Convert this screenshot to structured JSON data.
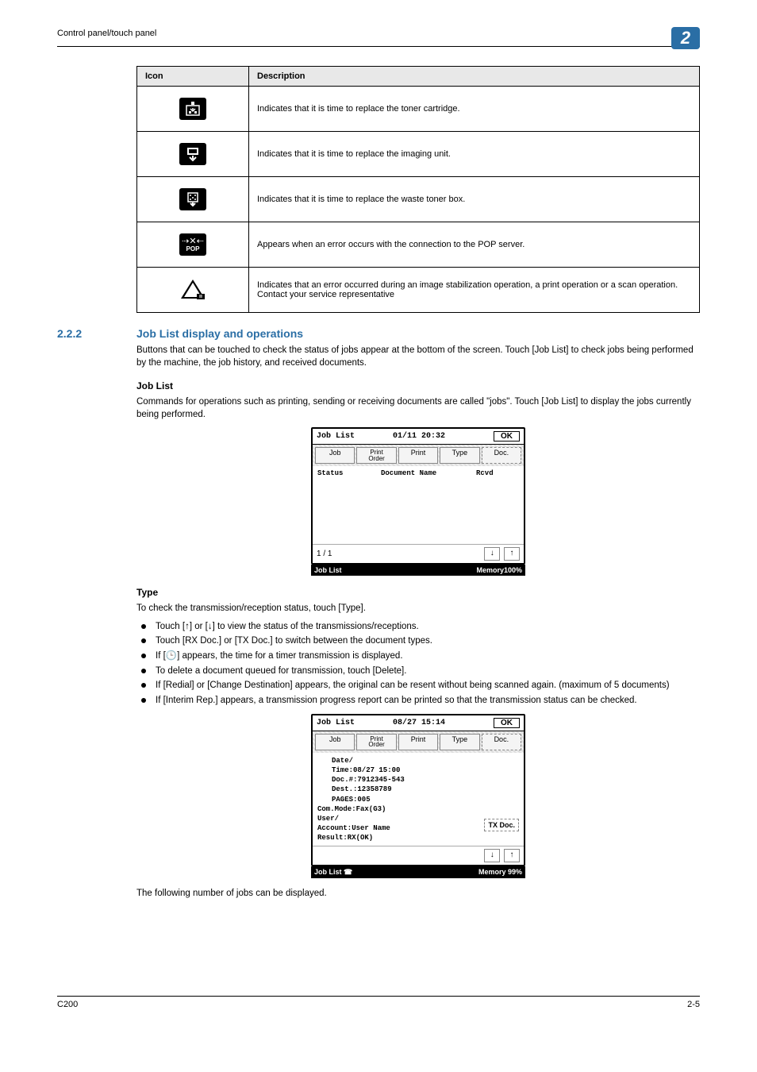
{
  "runningHead": "Control panel/touch panel",
  "chapter": "2",
  "iconTable": {
    "headers": [
      "Icon",
      "Description"
    ],
    "rows": [
      {
        "iconName": "toner-cartridge-icon",
        "glyph": "⊞",
        "desc": "Indicates that it is time to replace the toner cartridge."
      },
      {
        "iconName": "imaging-unit-icon",
        "glyph": "⬒",
        "desc": "Indicates that it is time to replace the imaging unit."
      },
      {
        "iconName": "waste-toner-icon",
        "glyph": "▦",
        "desc": "Indicates that it is time to replace the waste toner box."
      },
      {
        "iconName": "pop-error-icon",
        "glyph": "POP",
        "desc": "Appears when an error occurs with the connection to the POP server."
      },
      {
        "iconName": "service-error-icon",
        "glyph": "triangle",
        "desc": "Indicates that an error occurred during an image stabilization operation, a print operation or a scan operation.\nContact your service representative"
      }
    ]
  },
  "section": {
    "num": "2.2.2",
    "title": "Job List display and operations",
    "intro": "Buttons that can be touched to check the status of jobs appear at the bottom of the screen. Touch [Job List] to check jobs being performed by the machine, the job history, and received documents."
  },
  "jobList": {
    "heading": "Job List",
    "text": "Commands for operations such as printing, sending or receiving documents are called \"jobs\". Touch [Job List] to display the jobs currently being performed."
  },
  "screen1": {
    "title": "Job List",
    "datetime": "01/11 20:32",
    "ok": "OK",
    "tabs": {
      "job": "Job",
      "printOrder": "Print\nOrder",
      "print": "Print",
      "type": "Type",
      "doc": "Doc."
    },
    "colStatus": "Status",
    "colDocName": "Document Name",
    "colRcvd": "Rcvd",
    "pager": "1 / 1",
    "barLeft": "Job List",
    "barRight": "Memory100%"
  },
  "type": {
    "heading": "Type",
    "lead": "To check the transmission/reception status, touch [Type].",
    "bullets": [
      "Touch [↑] or [↓] to view the status of the transmissions/receptions.",
      "Touch [RX Doc.] or [TX Doc.] to switch between the document types.",
      "If [🕒] appears, the time for a timer transmission is displayed.",
      "To delete a document queued for transmission, touch [Delete].",
      "If [Redial] or [Change Destination] appears, the original can be resent without being scanned again. (maximum of 5 documents)",
      "If [Interim Rep.] appears, a transmission progress report can be printed so that the transmission status can be checked."
    ]
  },
  "screen2": {
    "title": "Job List",
    "datetime": "08/27 15:14",
    "ok": "OK",
    "tabs": {
      "job": "Job",
      "printOrder": "Print\nOrder",
      "print": "Print",
      "type": "Type",
      "doc": "Doc."
    },
    "lineDateTime": "Date/\nTime:08/27 15:00",
    "lineDoc": "Doc.#:7912345-543",
    "lineDest": "Dest.:12358789",
    "linePages": "PAGES:005",
    "lineComMode": "Com.Mode:Fax(G3)",
    "lineUser": "User/\nAccount:User Name",
    "lineResult": "Result:RX(OK)",
    "txDoc": "TX Doc.",
    "barLeft": "Job List ☎",
    "barRight": "Memory 99%"
  },
  "afterText": "The following number of jobs can be displayed.",
  "footer": {
    "left": "C200",
    "right": "2-5"
  }
}
